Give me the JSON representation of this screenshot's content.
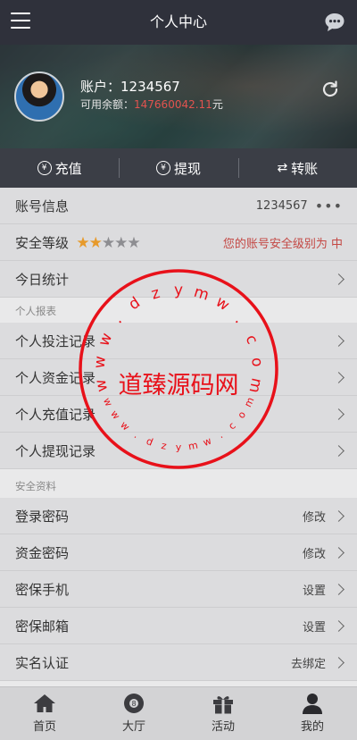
{
  "header": {
    "title": "个人中心",
    "menu_icon": "menu-icon",
    "chat_icon": "chat-bubble-icon"
  },
  "profile": {
    "account_label": "账户：",
    "account_value": "1234567",
    "balance_label": "可用余额：",
    "balance_value": "147660042.11",
    "balance_unit": "元"
  },
  "actions": [
    {
      "label": "充值",
      "icon": "yen-coin-icon"
    },
    {
      "label": "提现",
      "icon": "yen-coin-icon"
    },
    {
      "label": "转账",
      "icon": "transfer-arrows-icon"
    }
  ],
  "account_rows": {
    "info": {
      "label": "账号信息",
      "value": "1234567"
    },
    "security": {
      "label": "安全等级",
      "stars_on": 2,
      "stars_total": 5,
      "note": "您的账号安全级别为 中"
    },
    "stats": {
      "label": "今日统计"
    }
  },
  "report_section": {
    "title": "个人报表",
    "items": [
      "个人投注记录",
      "个人资金记录",
      "个人充值记录",
      "个人提现记录"
    ]
  },
  "security_section": {
    "title": "安全资料",
    "items": [
      {
        "label": "登录密码",
        "action": "修改"
      },
      {
        "label": "资金密码",
        "action": "修改"
      },
      {
        "label": "密保手机",
        "action": "设置"
      },
      {
        "label": "密保邮箱",
        "action": "设置"
      },
      {
        "label": "实名认证",
        "action": "去绑定"
      }
    ]
  },
  "tabbar": [
    {
      "label": "首页",
      "icon": "home-icon"
    },
    {
      "label": "大厅",
      "icon": "billiard-ball-icon"
    },
    {
      "label": "活动",
      "icon": "gift-icon"
    },
    {
      "label": "我的",
      "icon": "user-icon"
    }
  ],
  "watermark": {
    "center_text": "道臻源码网",
    "ring_text": "www.dzymw.com"
  },
  "colors": {
    "header_bg": "#2f313b",
    "accent_red": "#e2534f",
    "star": "#e79a2b",
    "stamp_red": "#e8111a"
  }
}
